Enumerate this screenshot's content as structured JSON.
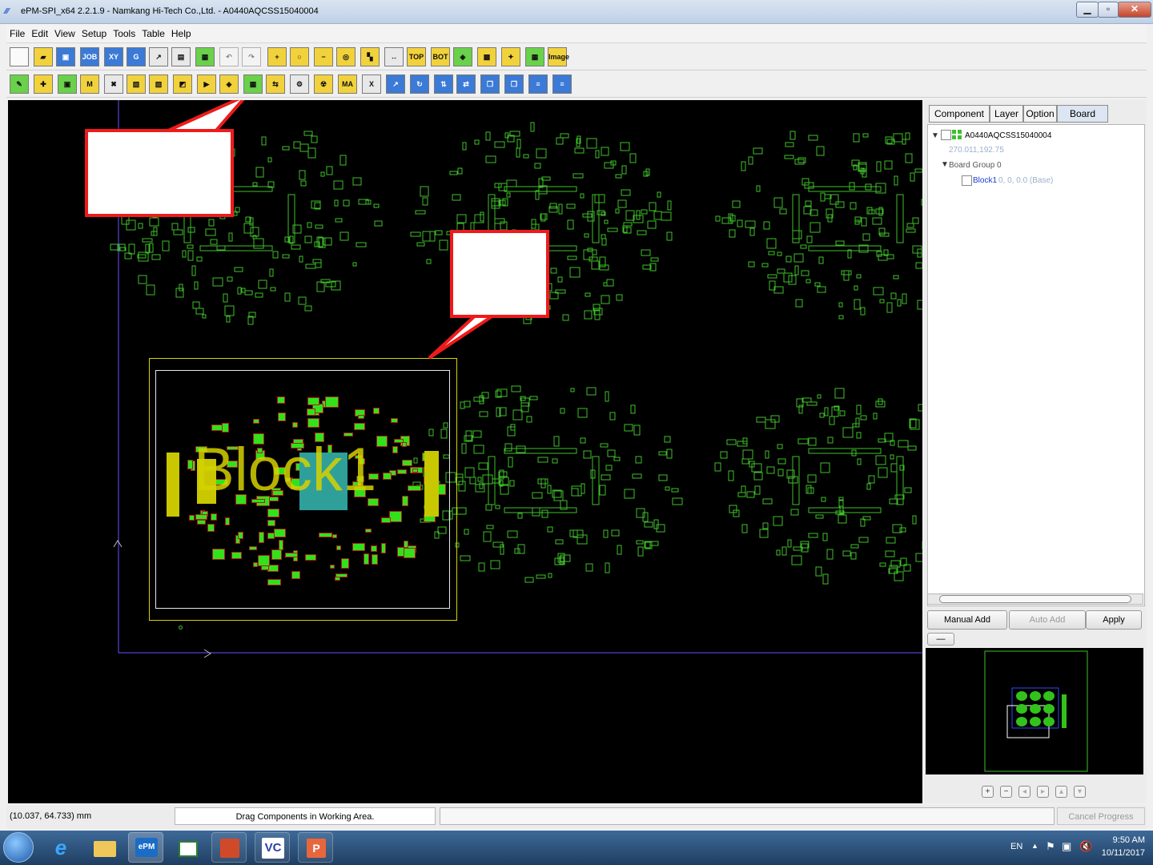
{
  "window": {
    "title": "ePM-SPI_x64 2.2.1.9 - Namkang Hi-Tech Co.,Ltd. - A0440AQCSS15040004",
    "minimize": "▁",
    "maximize": "▫",
    "close": "✕"
  },
  "menu": [
    "File",
    "Edit",
    "View",
    "Setup",
    "Tools",
    "Table",
    "Help"
  ],
  "toolbar1": [
    {
      "icon": "new-file-icon",
      "glyph": ""
    },
    {
      "icon": "open-folder-icon",
      "glyph": "▰"
    },
    {
      "icon": "save-icon",
      "glyph": "▣"
    },
    {
      "icon": "job-icon",
      "glyph": "JOB"
    },
    {
      "icon": "xy-icon",
      "glyph": "XY"
    },
    {
      "icon": "gerber-icon",
      "glyph": "G"
    },
    {
      "icon": "export-icon",
      "glyph": "↗"
    },
    {
      "icon": "film-icon",
      "glyph": "▤"
    },
    {
      "icon": "grid-icon",
      "glyph": "▦"
    },
    {
      "icon": "undo-icon",
      "glyph": "↶"
    },
    {
      "icon": "redo-icon",
      "glyph": "↷"
    },
    {
      "icon": "zoom-in-icon",
      "glyph": "+"
    },
    {
      "icon": "zoom-icon",
      "glyph": "○"
    },
    {
      "icon": "zoom-out-icon",
      "glyph": "−"
    },
    {
      "icon": "zoom-fit-icon",
      "glyph": "◎"
    },
    {
      "icon": "layers-icon",
      "glyph": "▚"
    },
    {
      "icon": "measure-icon",
      "glyph": "↔"
    },
    {
      "icon": "top-icon",
      "glyph": "TOP"
    },
    {
      "icon": "bottom-icon",
      "glyph": "BOT"
    },
    {
      "icon": "chip-icon",
      "glyph": "◈"
    },
    {
      "icon": "component-icon",
      "glyph": "▩"
    },
    {
      "icon": "light-icon",
      "glyph": "✦"
    },
    {
      "icon": "board-icon",
      "glyph": "▦"
    },
    {
      "icon": "image-icon",
      "glyph": "Image"
    }
  ],
  "toolbar2": [
    {
      "icon": "pen-icon",
      "glyph": "✎"
    },
    {
      "icon": "fiducial-icon",
      "glyph": "✚"
    },
    {
      "icon": "pad-icon",
      "glyph": "▣"
    },
    {
      "icon": "mark-icon",
      "glyph": "M"
    },
    {
      "icon": "part-icon",
      "glyph": "✖"
    },
    {
      "icon": "place-icon",
      "glyph": "▧"
    },
    {
      "icon": "place2-icon",
      "glyph": "▧"
    },
    {
      "icon": "align-icon",
      "glyph": "◩"
    },
    {
      "icon": "run-icon",
      "glyph": "▶"
    },
    {
      "icon": "chip-alert-icon",
      "glyph": "◈"
    },
    {
      "icon": "board-array-icon",
      "glyph": "▦"
    },
    {
      "icon": "merge-icon",
      "glyph": "⇆"
    },
    {
      "icon": "gear-icon",
      "glyph": "⚙"
    },
    {
      "icon": "radiation-icon",
      "glyph": "☢"
    },
    {
      "icon": "ma-icon",
      "glyph": "MA"
    },
    {
      "icon": "delete-icon",
      "glyph": "X"
    },
    {
      "icon": "move-icon",
      "glyph": "↗"
    },
    {
      "icon": "rotate-icon",
      "glyph": "↻"
    },
    {
      "icon": "mirror-icon",
      "glyph": "⇅"
    },
    {
      "icon": "flip-icon",
      "glyph": "⇄"
    },
    {
      "icon": "copy-icon",
      "glyph": "❐"
    },
    {
      "icon": "copy2-icon",
      "glyph": "❐"
    },
    {
      "icon": "list-all-icon",
      "glyph": "≡"
    },
    {
      "icon": "list-all2-icon",
      "glyph": "≡"
    }
  ],
  "callouts": {
    "toolbar_callout": "",
    "block_callout": ""
  },
  "canvas": {
    "block_label": "Block1"
  },
  "panel": {
    "tabs": [
      "Component",
      "Layer",
      "Option",
      "Board Array"
    ],
    "active_tab": "Board Array",
    "tree": {
      "root_name": "A0440AQCSS15040004",
      "root_coords": "270.011,192.75",
      "group": "Board Group 0",
      "block_name": "Block1",
      "block_info": "0, 0, 0.0 (Base)"
    },
    "buttons": {
      "manual_add": "Manual Add",
      "auto_add": "Auto Add",
      "apply": "Apply",
      "minus": "—"
    },
    "nav": [
      "+",
      "−",
      "◂",
      "▸",
      "▴",
      "▾"
    ]
  },
  "status": {
    "coords": "(10.037, 64.733) mm",
    "message": "Drag Components in Working Area.",
    "cancel": "Cancel Progress"
  },
  "taskbar": {
    "apps": [
      "start",
      "ie",
      "explorer",
      "ePM",
      "app",
      "outlook",
      "vc",
      "powerpoint"
    ],
    "epm_label": "ePM",
    "vc_label": "VC",
    "language": "EN",
    "time": "9:50 AM",
    "date": "10/11/2017"
  }
}
